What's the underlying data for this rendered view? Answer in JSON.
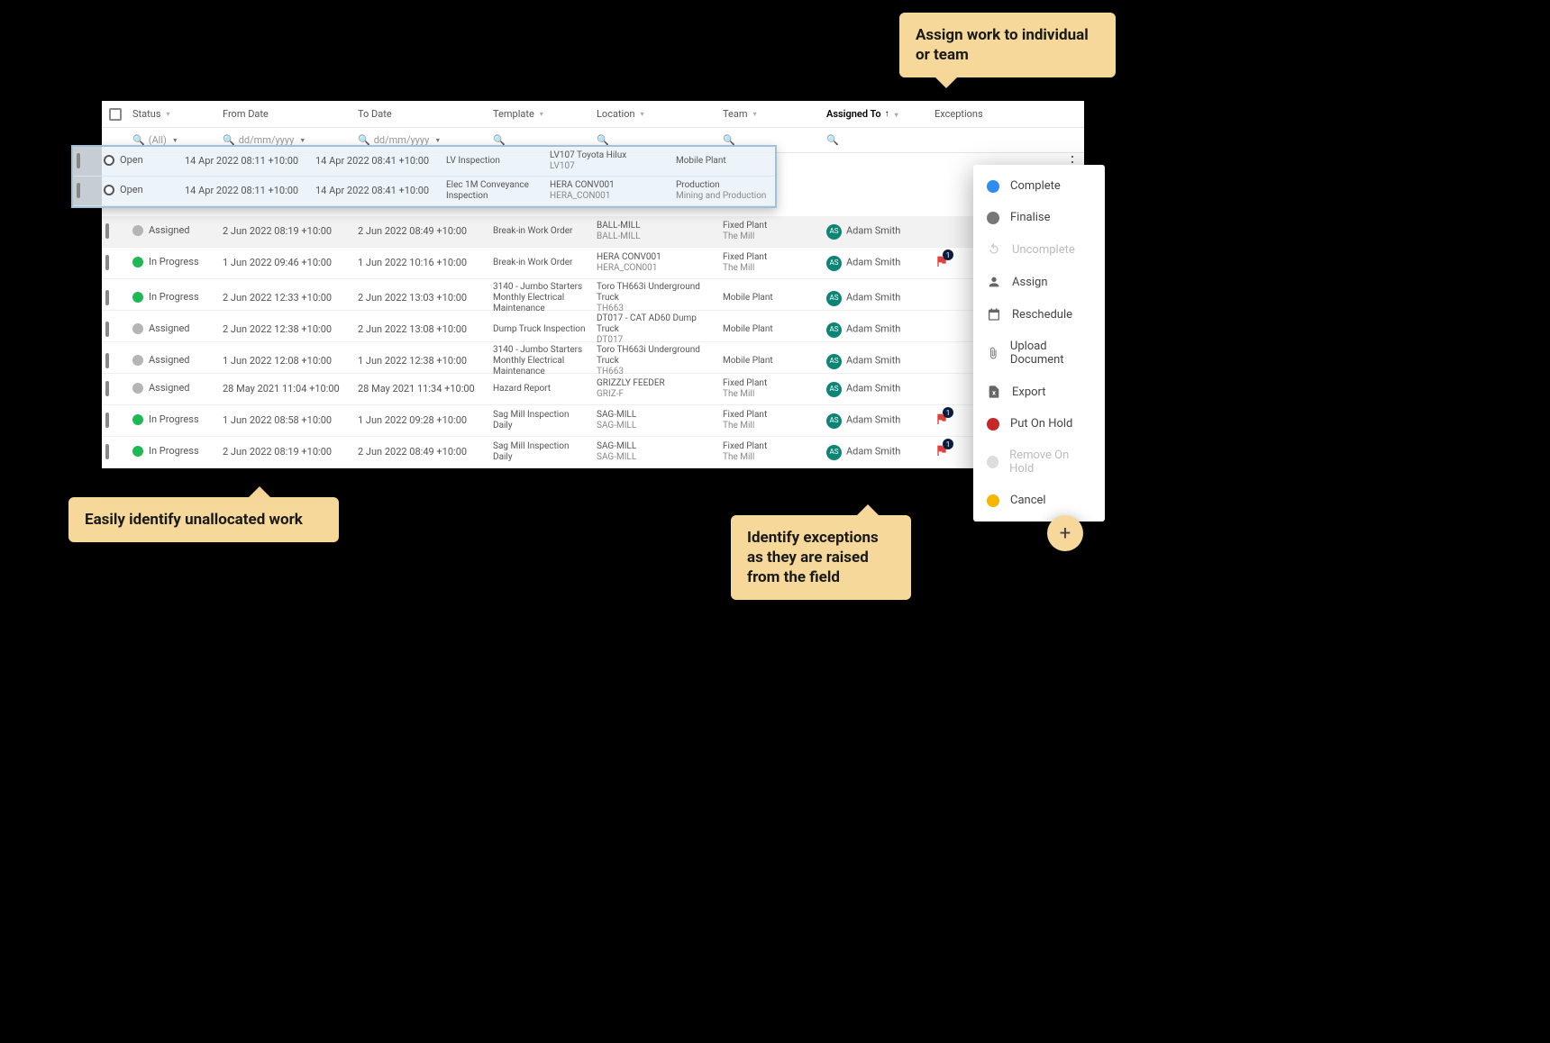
{
  "callouts": {
    "assign": "Assign work to individual or team",
    "unallocated": "Easily identify unallocated work",
    "exceptions": "Identify exceptions as they are raised from the field"
  },
  "headers": {
    "status": "Status",
    "from": "From Date",
    "to": "To Date",
    "template": "Template",
    "location": "Location",
    "team": "Team",
    "assigned": "Assigned To",
    "exceptions": "Exceptions"
  },
  "filters": {
    "all": "(All)",
    "date_placeholder": "dd/mm/yyyy"
  },
  "highlighted": [
    {
      "status": "Open",
      "from": "14 Apr 2022 08:11 +10:00",
      "to": "14 Apr 2022 08:41 +10:00",
      "template": "LV Inspection",
      "loc1": "LV107 Toyota Hilux",
      "loc2": "LV107",
      "team1": "Mobile Plant",
      "team2": ""
    },
    {
      "status": "Open",
      "from": "14 Apr 2022 08:11 +10:00",
      "to": "14 Apr 2022 08:41 +10:00",
      "template": "Elec 1M Conveyance Inspection",
      "loc1": "HERA CONV001",
      "loc2": "HERA_CON001",
      "team1": "Production",
      "team2": "Mining and Production"
    }
  ],
  "rows": [
    {
      "status": "Assigned",
      "dot": "dot-assigned",
      "from": "2 Jun 2022 08:19 +10:00",
      "to": "2 Jun 2022 08:49 +10:00",
      "template": "Break-in Work Order",
      "loc1": "BALL-MILL",
      "loc2": "BALL-MILL",
      "team1": "Fixed Plant",
      "team2": "The Mill",
      "assigned": "Adam Smith",
      "ex": "",
      "hl": true
    },
    {
      "status": "In Progress",
      "dot": "dot-progress",
      "from": "1 Jun 2022 09:46 +10:00",
      "to": "1 Jun 2022 10:16 +10:00",
      "template": "Break-in Work Order",
      "loc1": "HERA CONV001",
      "loc2": "HERA_CON001",
      "team1": "Fixed Plant",
      "team2": "The Mill",
      "assigned": "Adam Smith",
      "ex": "1"
    },
    {
      "status": "In Progress",
      "dot": "dot-progress",
      "from": "2 Jun 2022 12:33 +10:00",
      "to": "2 Jun 2022 13:03 +10:00",
      "template": "3140 - Jumbo Starters Monthly Electrical Maintenance",
      "loc1": "Toro TH663i Underground Truck",
      "loc2": "TH663",
      "team1": "Mobile Plant",
      "team2": "",
      "assigned": "Adam Smith",
      "ex": ""
    },
    {
      "status": "Assigned",
      "dot": "dot-assigned",
      "from": "2 Jun 2022 12:38 +10:00",
      "to": "2 Jun 2022 13:08 +10:00",
      "template": "Dump Truck Inspection",
      "loc1": "DT017 - CAT AD60 Dump Truck",
      "loc2": "DT017",
      "team1": "Mobile Plant",
      "team2": "",
      "assigned": "Adam Smith",
      "ex": ""
    },
    {
      "status": "Assigned",
      "dot": "dot-assigned",
      "from": "1 Jun 2022 12:08 +10:00",
      "to": "1 Jun 2022 12:38 +10:00",
      "template": "3140 - Jumbo Starters Monthly Electrical Maintenance",
      "loc1": "Toro TH663i Underground Truck",
      "loc2": "TH663",
      "team1": "Mobile Plant",
      "team2": "",
      "assigned": "Adam Smith",
      "ex": ""
    },
    {
      "status": "Assigned",
      "dot": "dot-assigned",
      "from": "28 May 2021 11:04 +10:00",
      "to": "28 May 2021 11:34 +10:00",
      "template": "Hazard Report",
      "loc1": "GRIZZLY FEEDER",
      "loc2": "GRIZ-F",
      "team1": "Fixed Plant",
      "team2": "The Mill",
      "assigned": "Adam Smith",
      "ex": ""
    },
    {
      "status": "In Progress",
      "dot": "dot-progress",
      "from": "1 Jun 2022 08:58 +10:00",
      "to": "1 Jun 2022 09:28 +10:00",
      "template": "Sag Mill Inspection Daily",
      "loc1": "SAG-MILL",
      "loc2": "SAG-MILL",
      "team1": "Fixed Plant",
      "team2": "The Mill",
      "assigned": "Adam Smith",
      "ex": "1"
    },
    {
      "status": "In Progress",
      "dot": "dot-progress",
      "from": "2 Jun 2022 08:19 +10:00",
      "to": "2 Jun 2022 08:49 +10:00",
      "template": "Sag Mill Inspection Daily",
      "loc1": "SAG-MILL",
      "loc2": "SAG-MILL",
      "team1": "Fixed Plant",
      "team2": "The Mill",
      "assigned": "Adam Smith",
      "ex": "1"
    }
  ],
  "avatar_initials": "AS",
  "menu": {
    "complete": "Complete",
    "finalise": "Finalise",
    "uncomplete": "Uncomplete",
    "assign": "Assign",
    "reschedule": "Reschedule",
    "upload": "Upload Document",
    "export": "Export",
    "hold": "Put On Hold",
    "remove_hold": "Remove On Hold",
    "cancel": "Cancel"
  },
  "fab": "+"
}
